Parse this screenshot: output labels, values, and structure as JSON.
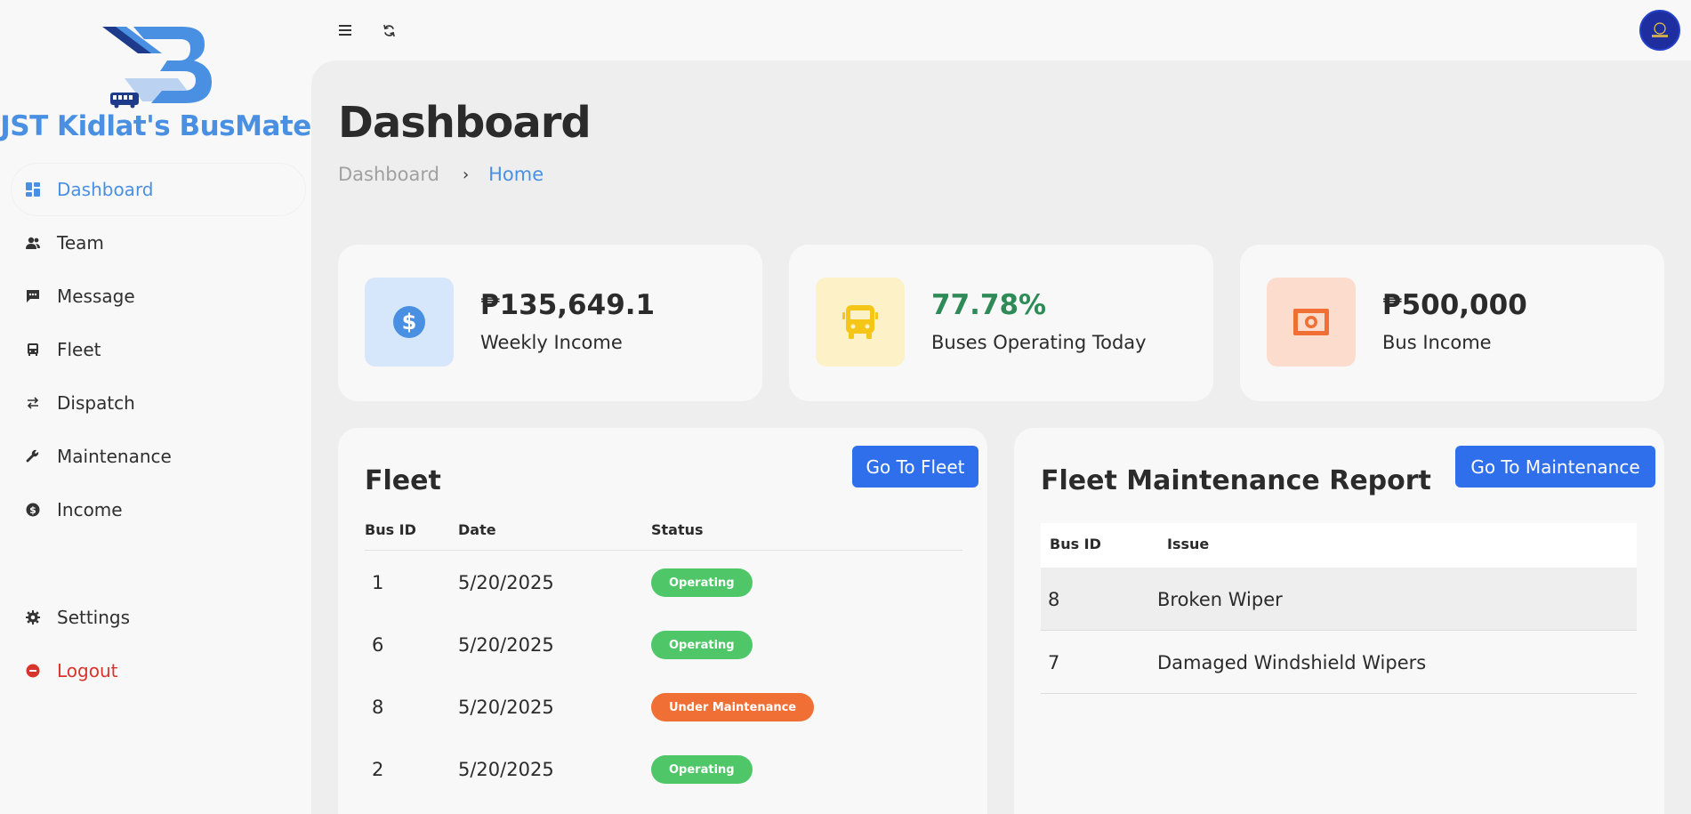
{
  "brand": {
    "name": "JST Kidlat's BusMate"
  },
  "sidebar": {
    "items": [
      {
        "label": "Dashboard",
        "icon": "dashboard-icon"
      },
      {
        "label": "Team",
        "icon": "team-icon"
      },
      {
        "label": "Message",
        "icon": "message-icon"
      },
      {
        "label": "Fleet",
        "icon": "bus-icon"
      },
      {
        "label": "Dispatch",
        "icon": "dispatch-icon"
      },
      {
        "label": "Maintenance",
        "icon": "wrench-icon"
      },
      {
        "label": "Income",
        "icon": "dollar-icon"
      }
    ],
    "bottom": [
      {
        "label": "Settings",
        "icon": "gear-icon"
      },
      {
        "label": "Logout",
        "icon": "logout-icon"
      }
    ]
  },
  "header": {
    "title": "Dashboard",
    "breadcrumb": {
      "first": "Dashboard",
      "separator": "›",
      "current": "Home"
    }
  },
  "stats": [
    {
      "value": "₱135,649.1",
      "label": "Weekly Income",
      "icon": "dollar-icon",
      "color": "#4a90e2"
    },
    {
      "value": "77.78%",
      "label": "Buses Operating Today",
      "icon": "bus-icon",
      "color": "#2e8b57"
    },
    {
      "value": "₱500,000",
      "label": "Bus Income",
      "icon": "cash-icon",
      "color": "#f06f34"
    }
  ],
  "fleet": {
    "title": "Fleet",
    "button": "Go To Fleet",
    "columns": [
      "Bus ID",
      "Date",
      "Status"
    ],
    "rows": [
      {
        "id": "1",
        "date": "5/20/2025",
        "status": "Operating"
      },
      {
        "id": "6",
        "date": "5/20/2025",
        "status": "Operating"
      },
      {
        "id": "8",
        "date": "5/20/2025",
        "status": "Under Maintenance"
      },
      {
        "id": "2",
        "date": "5/20/2025",
        "status": "Operating"
      }
    ]
  },
  "maintenance": {
    "title": "Fleet Maintenance Report",
    "button": "Go To Maintenance",
    "columns": [
      "Bus ID",
      "Issue"
    ],
    "rows": [
      {
        "id": "8",
        "issue": "Broken Wiper"
      },
      {
        "id": "7",
        "issue": "Damaged Windshield Wipers"
      }
    ]
  },
  "colors": {
    "accent": "#4a90e2",
    "primary_button": "#2f6fec",
    "operating": "#4fc769",
    "maintenance": "#f06f34",
    "logout": "#d9342b"
  }
}
